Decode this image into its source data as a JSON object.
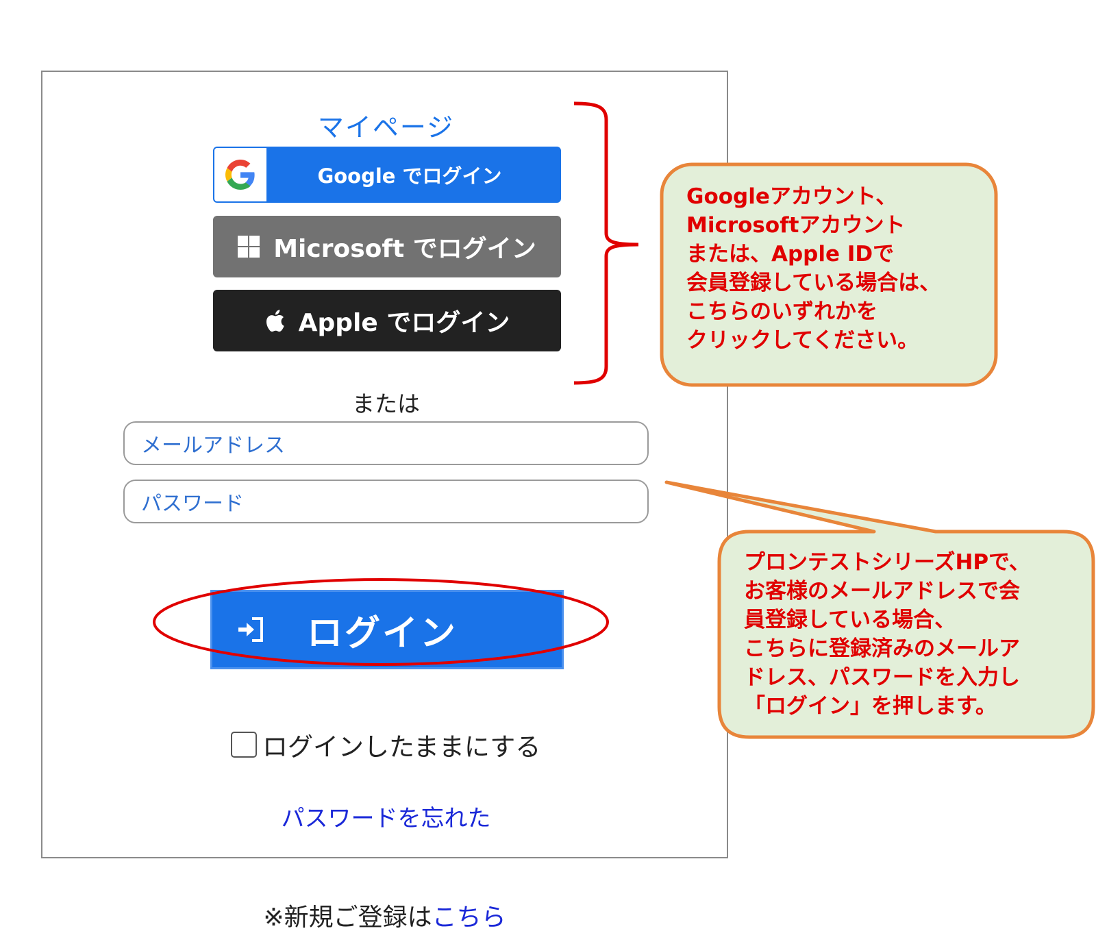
{
  "mypage": {
    "title": "マイページ"
  },
  "sso": {
    "google_label": "Google でログイン",
    "microsoft_label": "Microsoft でログイン",
    "apple_label": "Apple でログイン"
  },
  "or_text": "または",
  "form": {
    "email_placeholder": "メールアドレス",
    "password_placeholder": "パスワード",
    "login_label": "ログイン",
    "keep_logged_in": "ログインしたままにする",
    "forgot_password": "パスワードを忘れた"
  },
  "register": {
    "prefix": "※新規ご登録は",
    "link": "こちら"
  },
  "callouts": {
    "sso_note": "Googleアカウント、\nMicrosoftアカウント\nまたは、Apple IDで\n会員登録している場合は、\nこちらのいずれかを\nクリックしてください。",
    "email_note": "プロンテストシリーズHPで、\nお客様のメールアドレスで会\n員登録している場合、\nこちらに登録済みのメールア\nドレス、パスワードを入力し\n「ログイン」を押します。"
  },
  "colors": {
    "accent": "#1a73e8",
    "microsoft_button": "#727272",
    "apple_button": "#222222",
    "link": "#1a28d8",
    "annotation_red": "#e00000",
    "callout_fill": "#e3efd9",
    "callout_border": "#e8853a"
  },
  "icons": {
    "google": "google-g-icon",
    "microsoft": "windows-logo-icon",
    "apple": "apple-logo-icon",
    "login": "login-arrow-icon"
  }
}
